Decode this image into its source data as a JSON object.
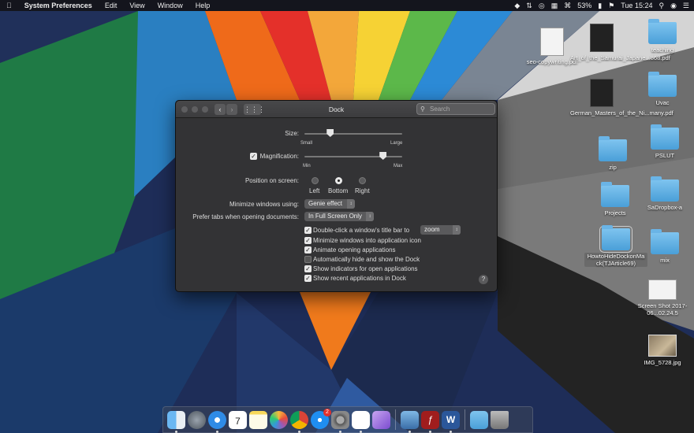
{
  "menubar": {
    "apple_icon": "apple-icon",
    "app_name": "System Preferences",
    "menus": [
      "Edit",
      "View",
      "Window",
      "Help"
    ],
    "battery": "53%",
    "clock": "Tue 15:24"
  },
  "window": {
    "title": "Dock",
    "search_placeholder": "Search",
    "size_label": "Size:",
    "size_min": "Small",
    "size_max": "Large",
    "size_value": 0.26,
    "magnification_label": "Magnification:",
    "magnification_checked": true,
    "mag_min": "Min",
    "mag_max": "Max",
    "mag_value": 0.8,
    "position_label": "Position on screen:",
    "positions": [
      "Left",
      "Bottom",
      "Right"
    ],
    "position_selected": "Bottom",
    "minimize_label": "Minimize windows using:",
    "minimize_value": "Genie effect",
    "tabs_label": "Prefer tabs when opening documents:",
    "tabs_value": "In Full Screen Only",
    "dblclick_label": "Double-click a window's title bar to",
    "dblclick_value": "zoom",
    "options": [
      {
        "label": "Minimize windows into application icon",
        "checked": true
      },
      {
        "label": "Animate opening applications",
        "checked": true
      },
      {
        "label": "Automatically hide and show the Dock",
        "checked": false
      },
      {
        "label": "Show indicators for open applications",
        "checked": true
      },
      {
        "label": "Show recent applications in Dock",
        "checked": true
      }
    ],
    "help": "?"
  },
  "desktop": {
    "items": [
      {
        "label": "seo-copywriting.pdf",
        "icon": "pdf-document-icon"
      },
      {
        "label": "Art_of_the_Samurai_Japane...868.pdf",
        "icon": "pdf-document-icon"
      },
      {
        "label": "teaching",
        "icon": "folder-icon"
      },
      {
        "label": "German_Masters_of_the_Ni...many.pdf",
        "icon": "pdf-document-icon"
      },
      {
        "label": "Uvac",
        "icon": "folder-icon"
      },
      {
        "label": "zip",
        "icon": "folder-icon"
      },
      {
        "label": "PSLUT",
        "icon": "folder-icon"
      },
      {
        "label": "Projects",
        "icon": "folder-icon"
      },
      {
        "label": "SaDropbox-a",
        "icon": "folder-icon"
      },
      {
        "label": "HowtoHideDockonMack(TJArticle69)",
        "icon": "folder-icon"
      },
      {
        "label": "mix",
        "icon": "folder-icon"
      },
      {
        "label": "Screen Shot 2017-06...02.24.5",
        "icon": "screenshot-icon"
      },
      {
        "label": "IMG_5728.jpg",
        "icon": "image-icon"
      }
    ]
  },
  "dock": {
    "calendar_day": "7",
    "appstore_badge": "2",
    "apps": [
      "finder-icon",
      "launchpad-icon",
      "safari-icon",
      "calendar-icon",
      "notes-icon",
      "photos-icon",
      "chrome-icon",
      "app-store-icon",
      "system-preferences-icon",
      "slack-icon",
      "feather-icon",
      "preview-icon",
      "filezilla-icon",
      "word-icon",
      "downloads-folder-icon",
      "trash-icon"
    ]
  }
}
